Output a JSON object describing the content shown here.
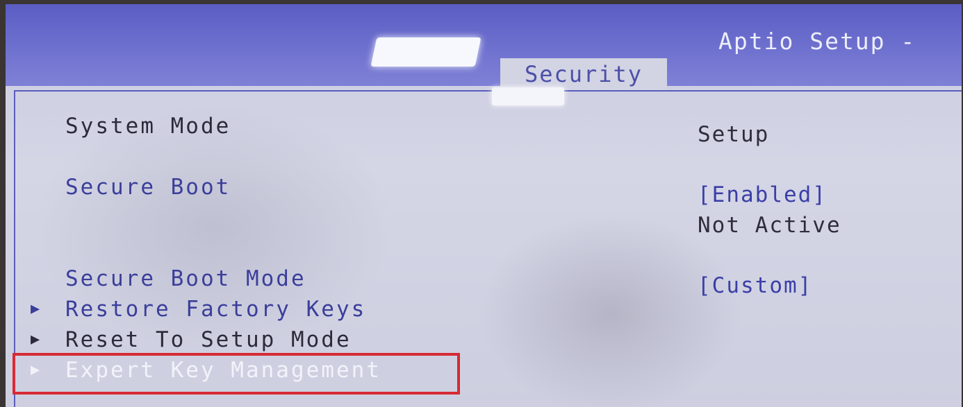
{
  "header": {
    "title": "Aptio Setup -",
    "active_tab": "Security"
  },
  "settings": {
    "system_mode": {
      "label": "System Mode",
      "value": "Setup"
    },
    "secure_boot": {
      "label": "Secure Boot",
      "value": "[Enabled]",
      "status": "Not Active"
    },
    "secure_boot_mode": {
      "label": "Secure Boot Mode",
      "value": "[Custom]"
    }
  },
  "submenus": [
    {
      "label": "Restore Factory Keys",
      "icon": "triangle-right-icon"
    },
    {
      "label": "Reset To Setup Mode",
      "icon": "triangle-right-icon"
    },
    {
      "label": "Expert Key Management",
      "icon": "triangle-right-icon",
      "selected": true
    }
  ],
  "colors": {
    "header_bg": "#5b5dc4",
    "body_bg": "#d2d4e4",
    "highlight_outline": "#d62a35"
  }
}
